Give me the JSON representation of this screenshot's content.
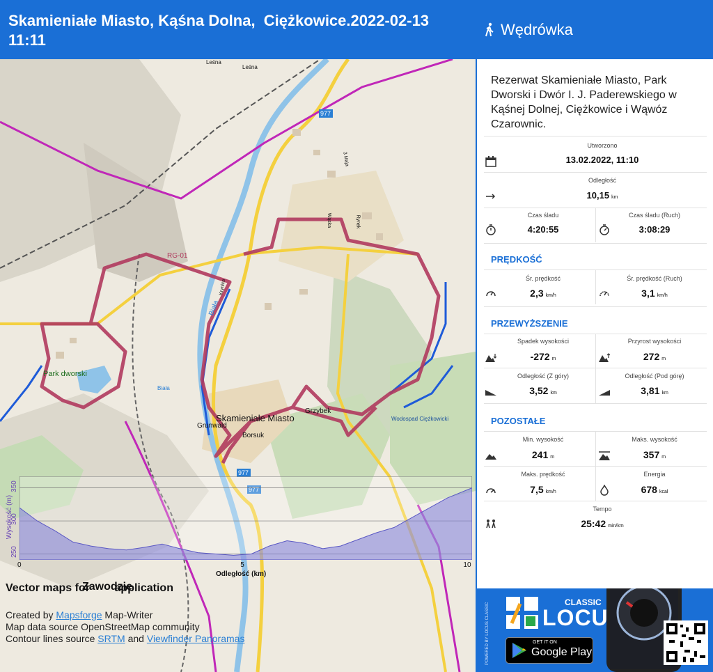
{
  "header": {
    "title": "Skamieniałe Miasto, Kąśna Dolna,  Ciężkowice.2022-02-13\n11:11",
    "activity": "Wędrówka",
    "activity_icon": "hiking-icon"
  },
  "panel": {
    "description": "Rezerwat Skamieniałe Miasto, Park Dworski i Dwór I. J. Paderewskiego w Kąśnej Dolnej, Ciężkowice i Wąwóz Czarownic.",
    "created_label": "Utworzono",
    "created_value": "13.02.2022, 11:10",
    "distance_label": "Odległość",
    "distance_value": "10,15",
    "distance_unit": "km",
    "track_time_label": "Czas śladu",
    "track_time_value": "4:20:55",
    "track_time_moving_label": "Czas śladu (Ruch)",
    "track_time_moving_value": "3:08:29",
    "speed_section": "PRĘDKOŚĆ",
    "avg_speed_label": "Śr. prędkość",
    "avg_speed_value": "2,3",
    "avg_speed_moving_label": "Śr. prędkość (Ruch)",
    "avg_speed_moving_value": "3,1",
    "speed_unit": "km/h",
    "elev_section": "PRZEWYŻSZENIE",
    "descent_label": "Spadek wysokości",
    "descent_value": "-272",
    "ascent_label": "Przyrost wysokości",
    "ascent_value": "272",
    "elev_unit": "m",
    "dist_down_label": "Odległość (Z góry)",
    "dist_down_value": "3,52",
    "dist_up_label": "Odległość (Pod górę)",
    "dist_up_value": "3,81",
    "other_section": "POZOSTAŁE",
    "min_elev_label": "Min. wysokość",
    "min_elev_value": "241",
    "max_elev_label": "Maks. wysokość",
    "max_elev_value": "357",
    "max_speed_label": "Maks. prędkość",
    "max_speed_value": "7,5",
    "energy_label": "Energia",
    "energy_value": "678",
    "energy_unit": "kcal",
    "tempo_label": "Tempo",
    "tempo_value": "25:42",
    "tempo_unit": "min/km"
  },
  "map": {
    "labels": [
      "Skamieniałe Miasto",
      "Park dworski",
      "Wodospad Ciężkowicki",
      "Grunwald",
      "Borsuk",
      "Grzybek",
      "Biała",
      "Biała",
      "Leśna",
      "Leśna",
      "RG-01",
      "977",
      "977",
      "977",
      "Wąska",
      "Rynek",
      "Krynica",
      "3 Maja",
      "Zawodzie"
    ],
    "vector_text": "Vector maps for",
    "vector_text_tail": "application",
    "credits_1_prefix": "Created by ",
    "credits_1_link": "Mapsforge",
    "credits_1_suffix": " Map-Writer",
    "credits_2": "Map data source OpenStreetMap community",
    "credits_3_prefix": "Contour lines source ",
    "credits_3_link": "SRTM",
    "credits_3_mid": " and ",
    "credits_3_link2": "Viewfinder Panoramas",
    "route_color": "#b03a5e",
    "river_color": "#8fc3e8",
    "road_color": "#f4d03f",
    "trail_color": "#c027b8"
  },
  "chart_data": {
    "type": "area",
    "ylabel": "Wysokość (m)",
    "xlabel": "Odległość (km)",
    "yticks": [
      "250",
      "300",
      "350"
    ],
    "xticks": [
      "0",
      "5",
      "10"
    ],
    "ylim": [
      241,
      357
    ],
    "xlim": [
      0,
      10.15
    ],
    "x": [
      0,
      0.4,
      0.8,
      1.2,
      1.6,
      2.0,
      2.4,
      2.8,
      3.2,
      3.6,
      4.0,
      4.4,
      4.8,
      5.2,
      5.6,
      6.0,
      6.4,
      6.8,
      7.2,
      7.6,
      8.0,
      8.4,
      8.8,
      9.2,
      9.6,
      10.15
    ],
    "y": [
      320,
      300,
      285,
      268,
      262,
      258,
      256,
      260,
      265,
      258,
      252,
      250,
      248,
      250,
      262,
      270,
      266,
      258,
      262,
      272,
      282,
      290,
      305,
      320,
      335,
      350
    ]
  },
  "promo": {
    "brand_small": "CLASSIC",
    "brand": "LOCUS",
    "store_small": "GET IT ON",
    "store": "Google Play",
    "powered": "POWERED BY LOCUS CLASSIC"
  }
}
